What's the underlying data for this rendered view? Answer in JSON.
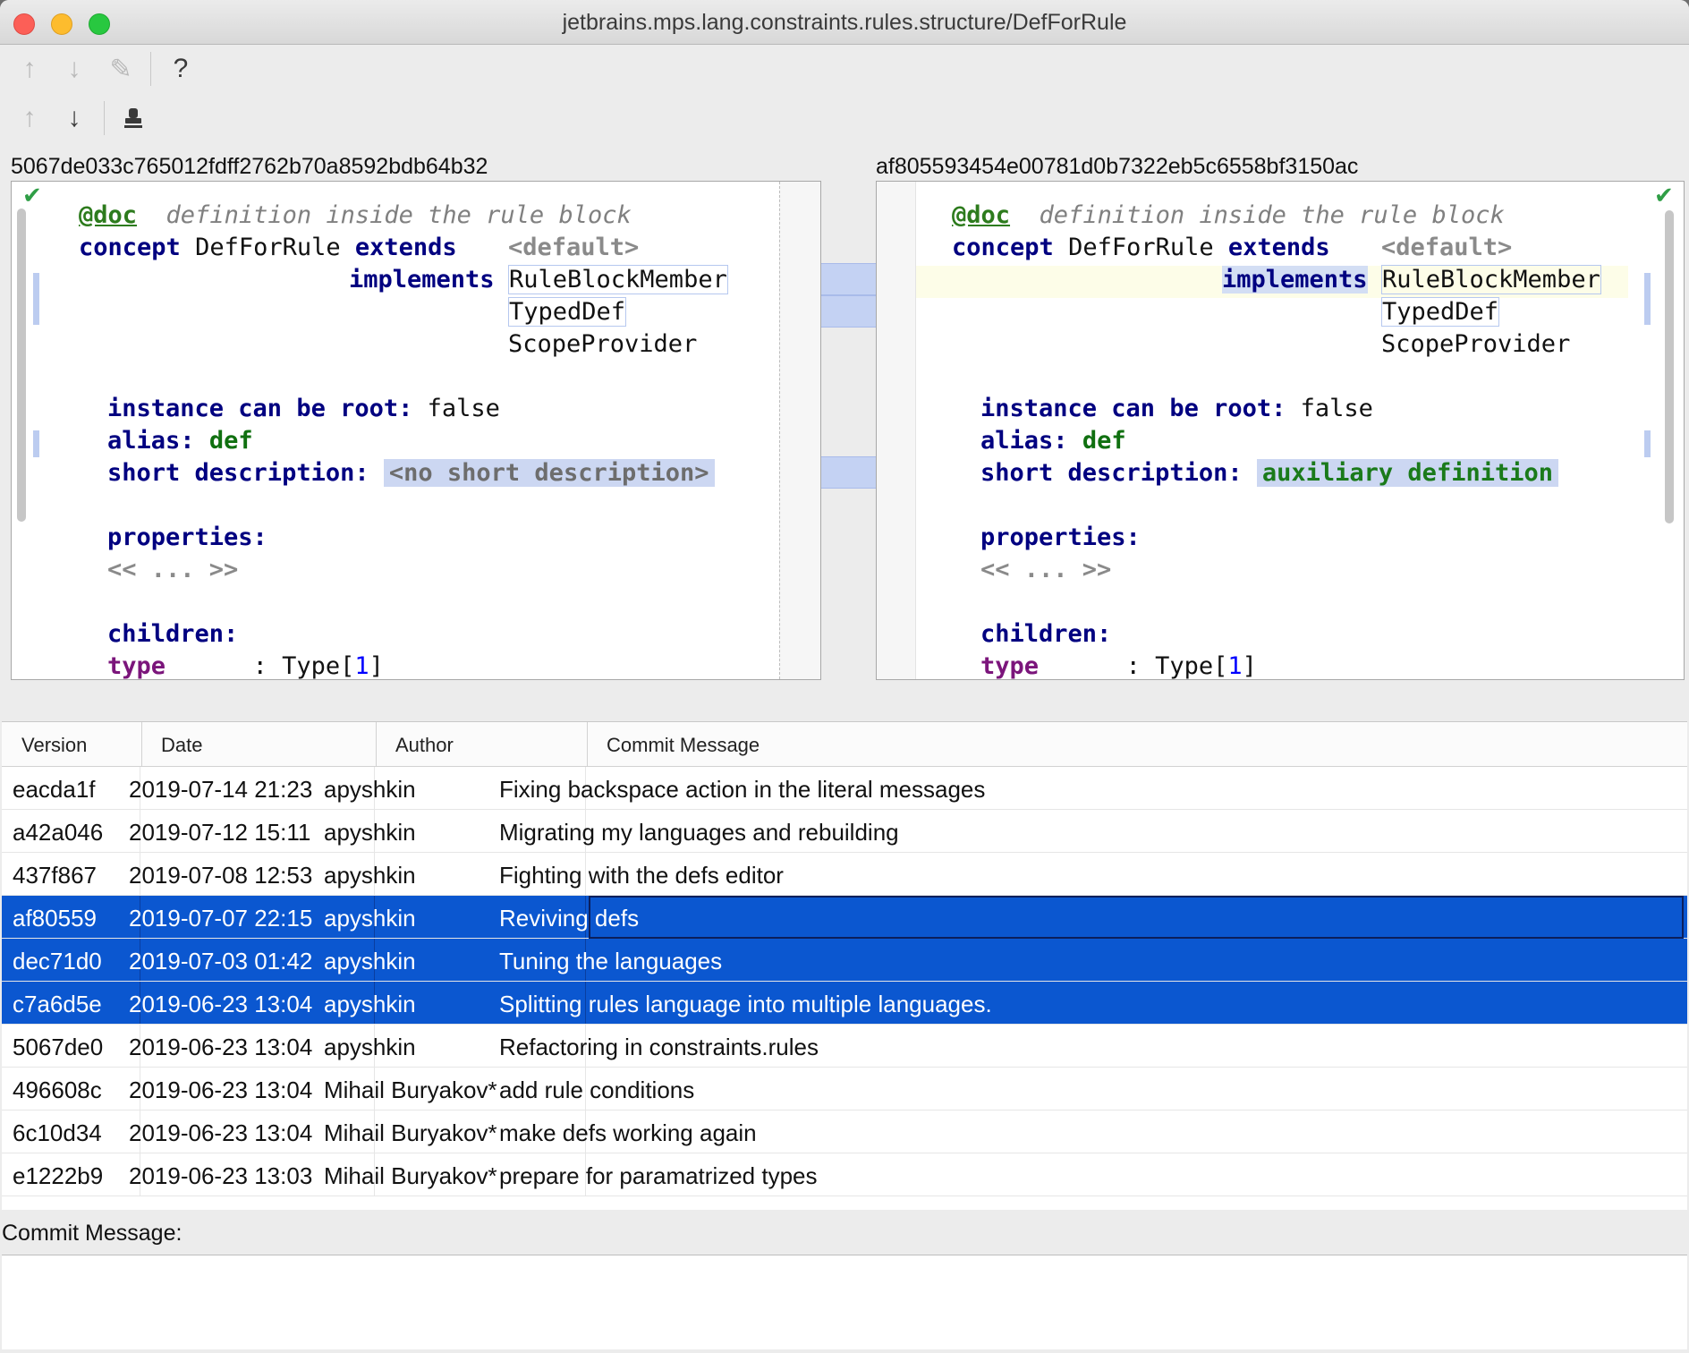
{
  "window": {
    "title": "jetbrains.mps.lang.constraints.rules.structure/DefForRule"
  },
  "toolbar1": {
    "up_icon": "arrow-up-icon",
    "down_icon": "arrow-down-icon",
    "edit_icon": "pencil-icon",
    "help_label": "?"
  },
  "toolbar2": {
    "up_icon": "arrow-up-icon",
    "down_icon": "arrow-down-icon",
    "stamp_icon": "stamp-icon"
  },
  "left": {
    "hash": "5067de033c765012fdff2762b70a8592bdb64b32",
    "doc": "@doc",
    "doc_text": "definition inside the rule block",
    "concept_kw": "concept",
    "concept_name": "DefForRule",
    "extends_kw": "extends",
    "default": "<default>",
    "implements_kw": "implements",
    "impl1": "RuleBlockMember",
    "impl2": "TypedDef",
    "impl3": "ScopeProvider",
    "root_kw": "instance can be root:",
    "root_val": "false",
    "alias_kw": "alias:",
    "alias_val": "def",
    "short_kw": "short description:",
    "short_val": "<no short description>",
    "props_kw": "properties:",
    "props_val": "<< ... >>",
    "children_kw": "children:",
    "child_name": "type",
    "child_type": ": Type[",
    "child_card": "1",
    "child_close": "]"
  },
  "right": {
    "hash": "af805593454e00781d0b7322eb5c6558bf3150ac",
    "doc": "@doc",
    "doc_text": "definition inside the rule block",
    "concept_kw": "concept",
    "concept_name": "DefForRule",
    "extends_kw": "extends",
    "default": "<default>",
    "implements_kw": "implements",
    "impl1": "RuleBlockMember",
    "impl2": "TypedDef",
    "impl3": "ScopeProvider",
    "root_kw": "instance can be root:",
    "root_val": "false",
    "alias_kw": "alias:",
    "alias_val": "def",
    "short_kw": "short description:",
    "short_val": "auxiliary definition",
    "props_kw": "properties:",
    "props_val": "<< ... >>",
    "children_kw": "children:",
    "child_name": "type",
    "child_type": ": Type[",
    "child_card": "1",
    "child_close": "]"
  },
  "status_icons": {
    "left": "checkmark-icon",
    "right": "checkmark-icon"
  },
  "table": {
    "columns": [
      "Version",
      "Date",
      "Author",
      "Commit Message"
    ],
    "rows": [
      {
        "version": "eacda1f",
        "date": "2019-07-14 21:23",
        "author": "apyshkin",
        "message": "Fixing backspace action in the literal messages",
        "selected": false
      },
      {
        "version": "a42a046",
        "date": "2019-07-12 15:11",
        "author": "apyshkin",
        "message": "Migrating my languages and rebuilding",
        "selected": false
      },
      {
        "version": "437f867",
        "date": "2019-07-08 12:53",
        "author": "apyshkin",
        "message": "Fighting with the defs editor",
        "selected": false
      },
      {
        "version": "af80559",
        "date": "2019-07-07 22:15",
        "author": "apyshkin",
        "message": "Reviving defs",
        "selected": true
      },
      {
        "version": "dec71d0",
        "date": "2019-07-03 01:42",
        "author": "apyshkin",
        "message": "Tuning the languages",
        "selected": true
      },
      {
        "version": "c7a6d5e",
        "date": "2019-06-23 13:04",
        "author": "apyshkin",
        "message": "Splitting rules language into multiple languages.",
        "selected": true
      },
      {
        "version": "5067de0",
        "date": "2019-06-23 13:04",
        "author": "apyshkin",
        "message": "Refactoring in constraints.rules",
        "selected": false
      },
      {
        "version": "496608c",
        "date": "2019-06-23 13:04",
        "author": "Mihail Buryakov*",
        "message": "add rule conditions",
        "selected": false
      },
      {
        "version": "6c10d34",
        "date": "2019-06-23 13:04",
        "author": "Mihail Buryakov*",
        "message": "make defs working again",
        "selected": false
      },
      {
        "version": "e1222b9",
        "date": "2019-06-23 13:03",
        "author": "Mihail Buryakov*",
        "message": "prepare for paramatrized types",
        "selected": false
      }
    ]
  },
  "commit_message": {
    "label": "Commit Message:",
    "value": ""
  }
}
